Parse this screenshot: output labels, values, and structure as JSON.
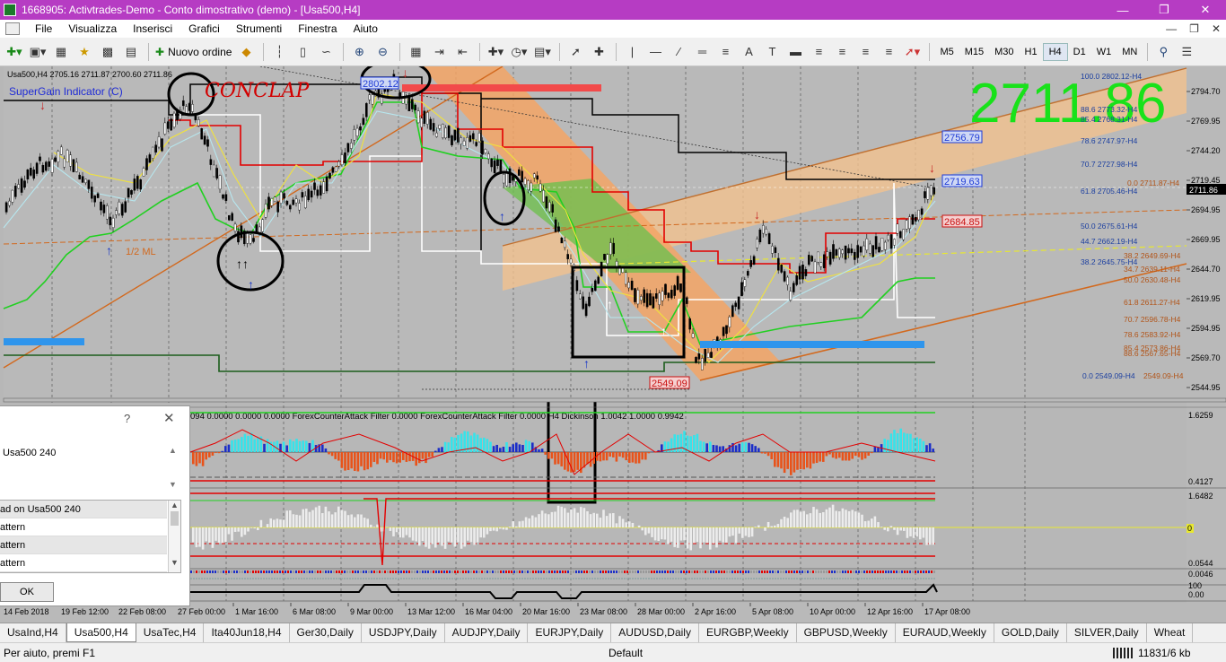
{
  "window": {
    "title": "1668905: Activtrades-Demo - Conto dimostrativo (demo) - [Usa500,H4]",
    "min_icon": "minimize-icon",
    "max_icon": "restore-icon",
    "close_icon": "close-icon"
  },
  "menu": {
    "items": [
      "File",
      "Visualizza",
      "Inserisci",
      "Grafici",
      "Strumenti",
      "Finestra",
      "Aiuto"
    ]
  },
  "toolbar": {
    "new_order_label": "Nuovo ordine",
    "timeframes": [
      "M5",
      "M15",
      "M30",
      "H1",
      "H4",
      "D1",
      "W1",
      "MN"
    ],
    "active_timeframe": "H4"
  },
  "chart": {
    "header": "Usa500,H4  2705.16 2711.87 2700.60 2711.86",
    "indicator_name": "SuperGain Indicator (C)",
    "big_price": "2711.86",
    "annotation_text": "CONCLAP",
    "half_ml": "1/2 ML",
    "price_axis": [
      "2794.70",
      "2769.95",
      "2744.20",
      "2719.45",
      "2694.95",
      "2669.95",
      "2644.70",
      "2619.95",
      "2594.95",
      "2569.70",
      "2544.95"
    ],
    "current_price_tag": "2711.86",
    "price_tags": [
      {
        "text": "2802.12"
      },
      {
        "text": "2756.79"
      },
      {
        "text": "2719.63"
      },
      {
        "text": "2684.85"
      },
      {
        "text": "2549.09"
      }
    ],
    "fib_labels": [
      "100.0 2802.12-H4",
      "88.6 2773.32-H4",
      "85.4 2768.31-H4",
      "78.6 2747.97-H4",
      "70.7 2727.98-H4",
      "0.0 2711.87-H4",
      "61.8 2705.46-H4",
      "50.0 2675.61-H4",
      "44.7 2662.19-H4",
      "38.2 2649.69-H4",
      "38.2 2645.75-H4",
      "34.7 2639.11-H4",
      "50.0 2630.48-H4",
      "61.8 2611.27-H4",
      "70.7 2596.78-H4",
      "78.6 2583.92-H4",
      "85.4 2573.86-H4",
      "88.6 2567.65-H4",
      "0.0 2549.09-H4",
      "2549.09-H4"
    ],
    "osc1_text": "094 0.0000 0.0000 0.0000   ForexCounterAttack Filter 0.0000   ForexCounterAttack Filter 0.0000 H4 Dickinson 1.0042 1.0000 0.9942",
    "osc1_axis": [
      "1.6259",
      "0.4127"
    ],
    "osc2_axis": [
      "1.6482",
      "0",
      "0.0544",
      "0.0046"
    ],
    "osc3_axis": [
      "100",
      "0.00"
    ],
    "time_axis": [
      "14 Feb 2018",
      "19 Feb 12:00",
      "22 Feb 08:00",
      "27 Feb 00:00",
      "1 Mar 16:00",
      "6 Mar 08:00",
      "9 Mar 00:00",
      "13 Mar 12:00",
      "16 Mar 04:00",
      "20 Mar 16:00",
      "23 Mar 08:00",
      "28 Mar 00:00",
      "2 Apr 16:00",
      "5 Apr 08:00",
      "10 Apr 00:00",
      "12 Apr 16:00",
      "17 Apr 08:00"
    ]
  },
  "dialog": {
    "help": "?",
    "close": "✕",
    "text": "Usa500 240",
    "rows": [
      "ad on Usa500 240",
      "attern",
      "attern",
      "attern"
    ],
    "ok_label": "OK"
  },
  "tabs": [
    "UsaInd,H4",
    "Usa500,H4",
    "UsaTec,H4",
    "Ita40Jun18,H4",
    "Ger30,Daily",
    "USDJPY,Daily",
    "AUDJPY,Daily",
    "EURJPY,Daily",
    "AUDUSD,Daily",
    "EURGBP,Weekly",
    "GBPUSD,Weekly",
    "EURAUD,Weekly",
    "GOLD,Daily",
    "SILVER,Daily",
    "Wheat"
  ],
  "active_tab": "Usa500,H4",
  "status": {
    "help": "Per aiuto, premi F1",
    "profile": "Default",
    "traffic": "11831/6 kb"
  }
}
